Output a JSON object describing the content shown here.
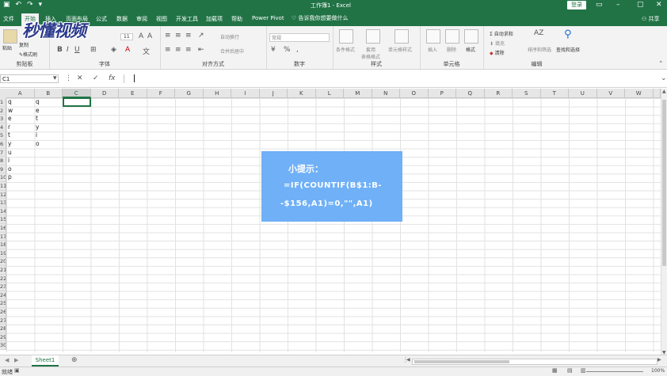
{
  "titlebar": {
    "title": "工作簿1  -  Excel",
    "login": "登录",
    "save_icon": "save-icon",
    "undo_icon": "undo-icon",
    "redo_icon": "redo-icon"
  },
  "tabs": [
    {
      "label": "文件"
    },
    {
      "label": "开始"
    },
    {
      "label": "插入"
    },
    {
      "label": "页面布局"
    },
    {
      "label": "公式"
    },
    {
      "label": "数据"
    },
    {
      "label": "审阅"
    },
    {
      "label": "视图"
    },
    {
      "label": "开发工具"
    },
    {
      "label": "加载项"
    },
    {
      "label": "帮助"
    },
    {
      "label": "Power Pivot"
    }
  ],
  "tellme": "告诉我你想要做什么",
  "share": "共享",
  "ribbon": {
    "clipboard": {
      "label": "剪贴板",
      "paste": "粘贴",
      "copy": "复制",
      "format_painter": "格式刷"
    },
    "font": {
      "label": "字体",
      "size": "11"
    },
    "alignment": {
      "label": "对齐方式",
      "wrap": "自动换行",
      "merge": "合并后居中"
    },
    "number": {
      "label": "数字",
      "format": "常规"
    },
    "styles": {
      "label": "样式",
      "conditional": "条件格式",
      "table": "套用\n表格格式",
      "cell_styles": "单元格样式"
    },
    "cells": {
      "label": "单元格",
      "insert": "插入",
      "delete": "删除",
      "format": "格式"
    },
    "editing": {
      "label": "编辑",
      "autosum": "自动求和",
      "fill": "填充",
      "clear": "清除",
      "sort": "排序和筛选",
      "find": "查找和选择"
    }
  },
  "watermark": "秒懂视频",
  "formulabar": {
    "namebox": "C1",
    "fx": "fx",
    "value": ""
  },
  "columns": [
    "A",
    "B",
    "C",
    "D",
    "E",
    "F",
    "G",
    "H",
    "I",
    "J",
    "K",
    "L",
    "M",
    "N",
    "O",
    "P",
    "Q",
    "R",
    "S",
    "T",
    "U",
    "V",
    "W"
  ],
  "selected_column": "C",
  "rows": [
    "1",
    "2",
    "3",
    "4",
    "5",
    "6",
    "7",
    "8",
    "9",
    "10",
    "11",
    "12",
    "13",
    "14",
    "15",
    "16",
    "17",
    "18",
    "19",
    "20",
    "21",
    "22",
    "23",
    "24",
    "25",
    "26",
    "27",
    "28",
    "29",
    "30"
  ],
  "cells": {
    "A": [
      "q",
      "w",
      "e",
      "r",
      "t",
      "y",
      "u",
      "i",
      "o",
      "p"
    ],
    "B": [
      "q",
      "e",
      "t",
      "y",
      "i",
      "o"
    ]
  },
  "tip": {
    "title": "小提示：",
    "line1": "=IF(COUNTIF(B$1:B-",
    "line2": "-$156,A1)=0,\"\",A1)"
  },
  "sheets": [
    {
      "name": "Sheet1"
    }
  ],
  "status": {
    "mode": "就绪",
    "zoom": "100%"
  }
}
